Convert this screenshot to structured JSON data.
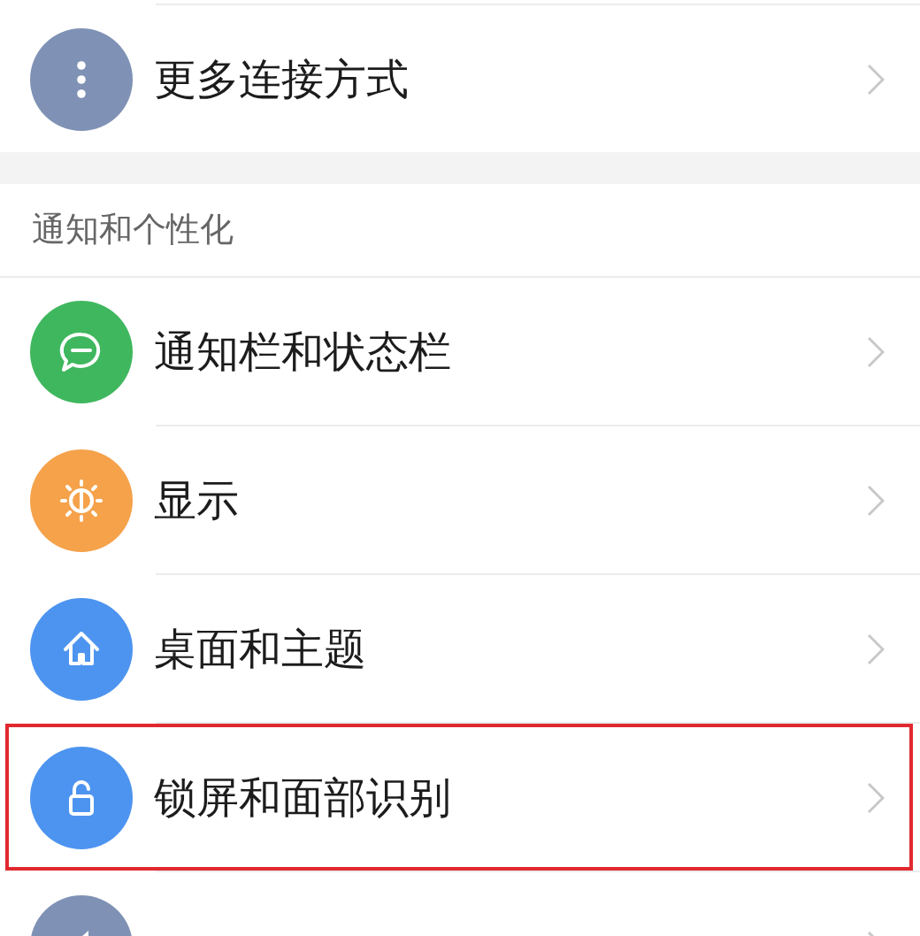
{
  "top_items": [
    {
      "label": "更多连接方式",
      "kind": "more",
      "color": "#7f92b5",
      "highlighted": false
    }
  ],
  "section": {
    "title": "通知和个性化",
    "items": [
      {
        "label": "通知栏和状态栏",
        "kind": "message",
        "color": "#3fb75e",
        "highlighted": false
      },
      {
        "label": "显示",
        "kind": "brightness",
        "color": "#f5a24b",
        "highlighted": false
      },
      {
        "label": "桌面和主题",
        "kind": "home",
        "color": "#4d94f0",
        "highlighted": false
      },
      {
        "label": "锁屏和面部识别",
        "kind": "lock",
        "color": "#4d94f0",
        "highlighted": true
      },
      {
        "kind": "sound",
        "color": "#7f92b5",
        "highlighted": false
      }
    ]
  }
}
